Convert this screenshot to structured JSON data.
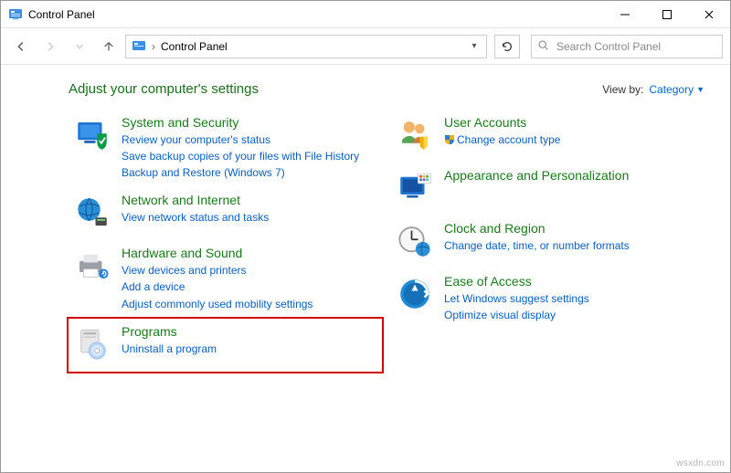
{
  "window": {
    "title": "Control Panel"
  },
  "nav": {
    "breadcrumb_root": "Control Panel",
    "search_placeholder": "Search Control Panel"
  },
  "header": {
    "adjust_heading": "Adjust your computer's settings",
    "view_by_label": "View by:",
    "view_by_value": "Category"
  },
  "categories": {
    "left": [
      {
        "id": "system-security",
        "title": "System and Security",
        "links": [
          "Review your computer's status",
          "Save backup copies of your files with File History",
          "Backup and Restore (Windows 7)"
        ]
      },
      {
        "id": "network-internet",
        "title": "Network and Internet",
        "links": [
          "View network status and tasks"
        ]
      },
      {
        "id": "hardware-sound",
        "title": "Hardware and Sound",
        "links": [
          "View devices and printers",
          "Add a device",
          "Adjust commonly used mobility settings"
        ]
      },
      {
        "id": "programs",
        "title": "Programs",
        "highlighted": true,
        "links": [
          "Uninstall a program"
        ]
      }
    ],
    "right": [
      {
        "id": "user-accounts",
        "title": "User Accounts",
        "links": [
          "Change account type"
        ]
      },
      {
        "id": "appearance-personalization",
        "title": "Appearance and Personalization",
        "links": []
      },
      {
        "id": "clock-region",
        "title": "Clock and Region",
        "links": [
          "Change date, time, or number formats"
        ]
      },
      {
        "id": "ease-of-access",
        "title": "Ease of Access",
        "links": [
          "Let Windows suggest settings",
          "Optimize visual display"
        ]
      }
    ]
  },
  "watermark": "wsxdn.com",
  "icons": {
    "shield_badge": true
  }
}
